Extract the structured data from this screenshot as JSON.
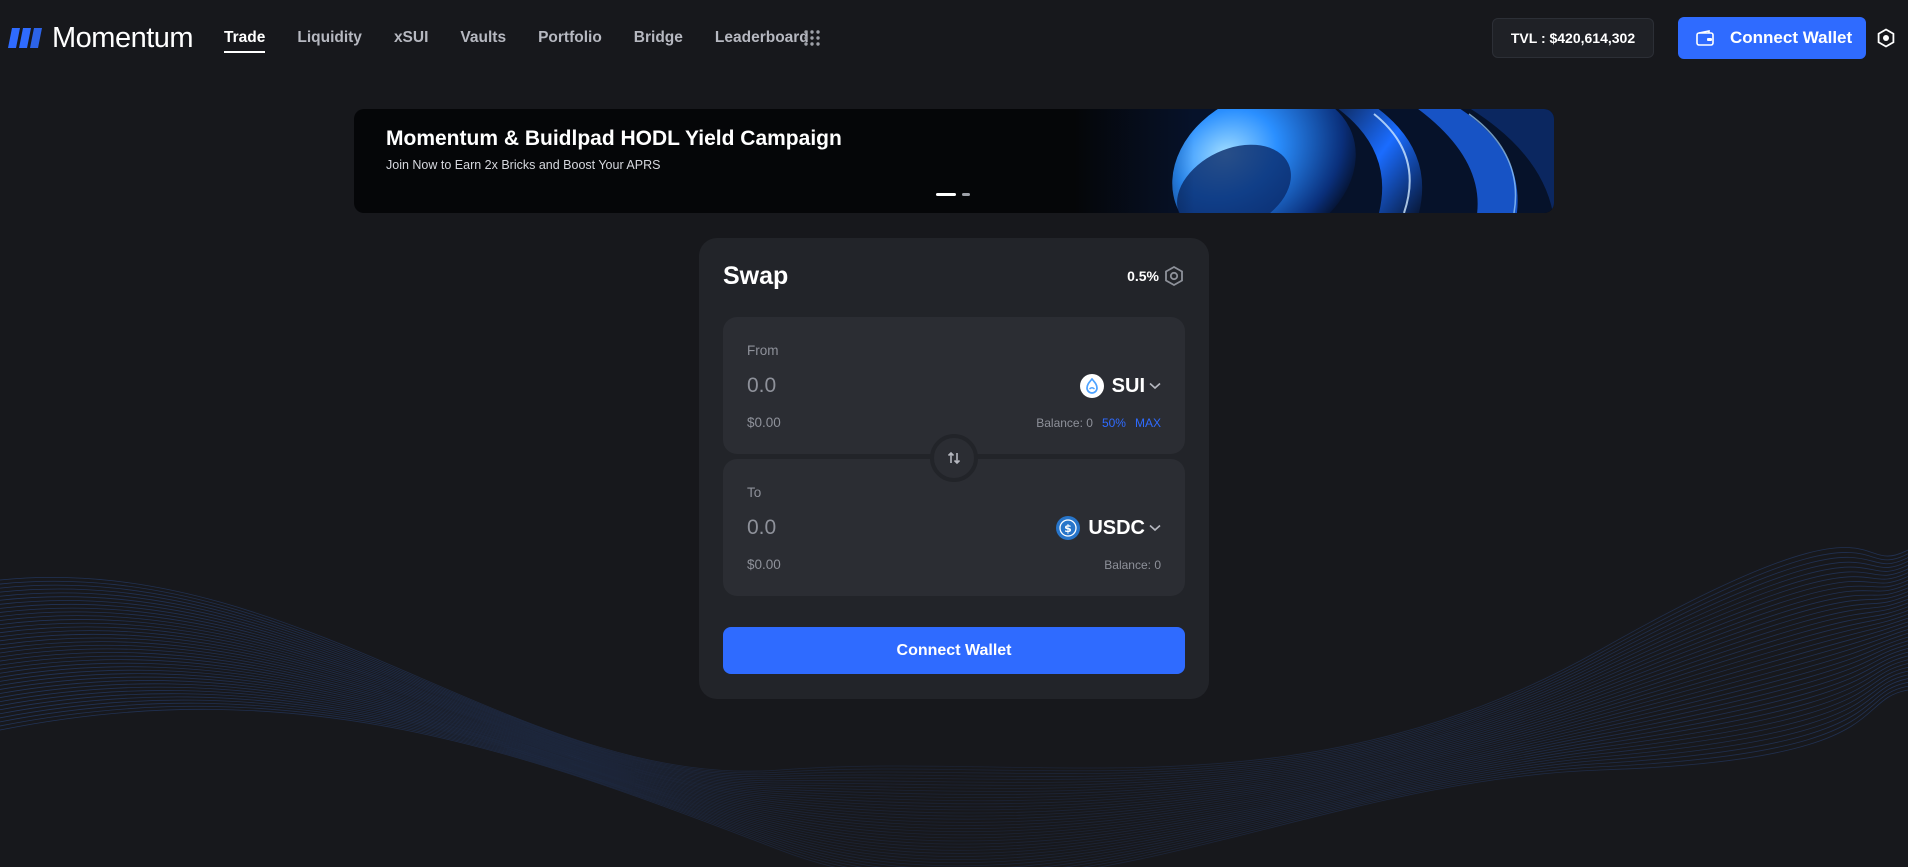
{
  "brand": {
    "name": "Momentum",
    "accent": "#2f6bff"
  },
  "nav": {
    "items": [
      {
        "label": "Trade",
        "active": true
      },
      {
        "label": "Liquidity",
        "active": false
      },
      {
        "label": "xSUI",
        "active": false
      },
      {
        "label": "Vaults",
        "active": false
      },
      {
        "label": "Portfolio",
        "active": false
      },
      {
        "label": "Bridge",
        "active": false
      },
      {
        "label": "Leaderboard",
        "active": false
      }
    ],
    "more_icon": "grid-dots-icon"
  },
  "header": {
    "tvl": "TVL : $420,614,302",
    "connect_label": "Connect Wallet",
    "wallet_icon": "wallet-icon",
    "settings_icon": "gear-icon"
  },
  "banner": {
    "title": "Momentum & Buidlpad HODL Yield Campaign",
    "subtitle": "Join Now to Earn 2x Bricks and Boost Your APRS",
    "slides": 2,
    "active_slide": 1
  },
  "swap": {
    "title": "Swap",
    "slippage": "0.5%",
    "from": {
      "label": "From",
      "placeholder": "0.0",
      "usd": "$0.00",
      "token": "SUI",
      "token_icon": "sui-token-icon",
      "balance": "Balance: 0",
      "half_label": "50%",
      "max_label": "MAX"
    },
    "to": {
      "label": "To",
      "placeholder": "0.0",
      "usd": "$0.00",
      "token": "USDC",
      "token_icon": "usdc-token-icon",
      "balance": "Balance: 0"
    },
    "switch_icon": "swap-arrows-icon",
    "connect_label": "Connect Wallet"
  }
}
